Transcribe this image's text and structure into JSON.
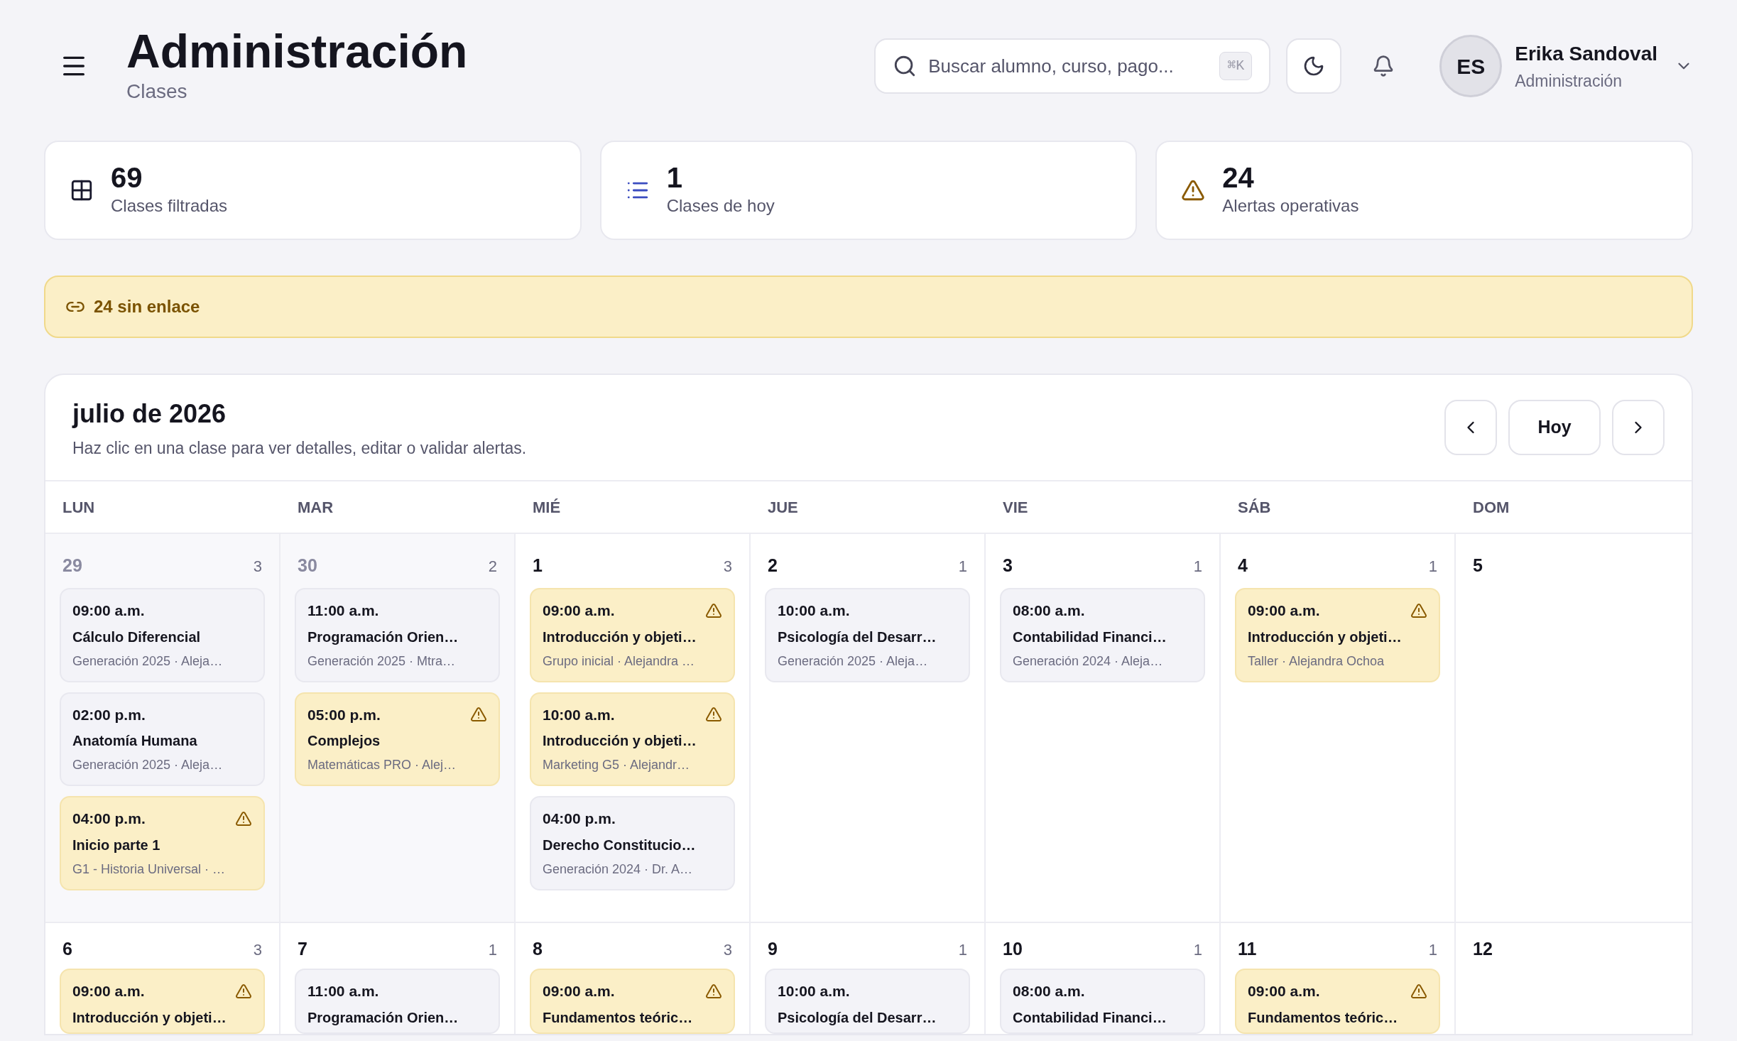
{
  "header": {
    "title": "Administración",
    "subtitle": "Clases"
  },
  "search": {
    "placeholder": "Buscar alumno, curso, pago...",
    "shortcut": "⌘K"
  },
  "user": {
    "initials": "ES",
    "name": "Erika Sandoval",
    "role": "Administración"
  },
  "stats": [
    {
      "kind": "grid",
      "value": "69",
      "label": "Clases filtradas"
    },
    {
      "kind": "list",
      "value": "1",
      "label": "Clases de hoy"
    },
    {
      "kind": "alert",
      "value": "24",
      "label": "Alertas operativas"
    }
  ],
  "banner": {
    "text": "24 sin enlace"
  },
  "calendar": {
    "title": "julio de 2026",
    "subtitle": "Haz clic en una clase para ver detalles, editar o validar alertas.",
    "today_button": "Hoy",
    "weekdays": [
      "LUN",
      "MAR",
      "MIÉ",
      "JUE",
      "VIE",
      "SÁB",
      "DOM"
    ],
    "weeks": [
      [
        {
          "number": "29",
          "count": "3",
          "muted": true,
          "events": [
            {
              "time": "09:00 a.m.",
              "title": "Cálculo Diferencial",
              "detail": "Generación 2025 · Aleja…",
              "alert": false
            },
            {
              "time": "02:00 p.m.",
              "title": "Anatomía Humana",
              "detail": "Generación 2025 · Aleja…",
              "alert": false
            },
            {
              "time": "04:00 p.m.",
              "title": "Inicio parte 1",
              "detail": "G1 - Historia Universal · …",
              "alert": true
            }
          ]
        },
        {
          "number": "30",
          "count": "2",
          "muted": true,
          "events": [
            {
              "time": "11:00 a.m.",
              "title": "Programación Orien…",
              "detail": "Generación 2025 · Mtra…",
              "alert": false
            },
            {
              "time": "05:00 p.m.",
              "title": "Complejos",
              "detail": "Matemáticas PRO · Alej…",
              "alert": true
            }
          ]
        },
        {
          "number": "1",
          "count": "3",
          "muted": false,
          "events": [
            {
              "time": "09:00 a.m.",
              "title": "Introducción y objeti…",
              "detail": "Grupo inicial · Alejandra …",
              "alert": true
            },
            {
              "time": "10:00 a.m.",
              "title": "Introducción y objeti…",
              "detail": "Marketing G5 · Alejandr…",
              "alert": true
            },
            {
              "time": "04:00 p.m.",
              "title": "Derecho Constitucio…",
              "detail": "Generación 2024 · Dr. A…",
              "alert": false
            }
          ]
        },
        {
          "number": "2",
          "count": "1",
          "muted": false,
          "events": [
            {
              "time": "10:00 a.m.",
              "title": "Psicología del Desarr…",
              "detail": "Generación 2025 · Aleja…",
              "alert": false
            }
          ]
        },
        {
          "number": "3",
          "count": "1",
          "muted": false,
          "events": [
            {
              "time": "08:00 a.m.",
              "title": "Contabilidad Financi…",
              "detail": "Generación 2024 · Aleja…",
              "alert": false
            }
          ]
        },
        {
          "number": "4",
          "count": "1",
          "muted": false,
          "events": [
            {
              "time": "09:00 a.m.",
              "title": "Introducción y objeti…",
              "detail": "Taller · Alejandra Ochoa",
              "alert": true
            }
          ]
        },
        {
          "number": "5",
          "muted": false
        }
      ],
      [
        {
          "number": "6",
          "count": "3",
          "muted": false,
          "events": [
            {
              "time": "09:00 a.m.",
              "title": "Introducción y objeti…",
              "alert": true
            }
          ]
        },
        {
          "number": "7",
          "count": "1",
          "muted": false,
          "events": [
            {
              "time": "11:00 a.m.",
              "title": "Programación Orien…",
              "alert": false
            }
          ]
        },
        {
          "number": "8",
          "count": "3",
          "muted": false,
          "events": [
            {
              "time": "09:00 a.m.",
              "title": "Fundamentos teóric…",
              "alert": true
            }
          ]
        },
        {
          "number": "9",
          "count": "1",
          "muted": false,
          "events": [
            {
              "time": "10:00 a.m.",
              "title": "Psicología del Desarr…",
              "alert": false
            }
          ]
        },
        {
          "number": "10",
          "count": "1",
          "muted": false,
          "events": [
            {
              "time": "08:00 a.m.",
              "title": "Contabilidad Financi…",
              "alert": false
            }
          ]
        },
        {
          "number": "11",
          "count": "1",
          "muted": false,
          "events": [
            {
              "time": "09:00 a.m.",
              "title": "Fundamentos teóric…",
              "alert": true
            }
          ]
        },
        {
          "number": "12",
          "muted": false
        }
      ]
    ]
  }
}
